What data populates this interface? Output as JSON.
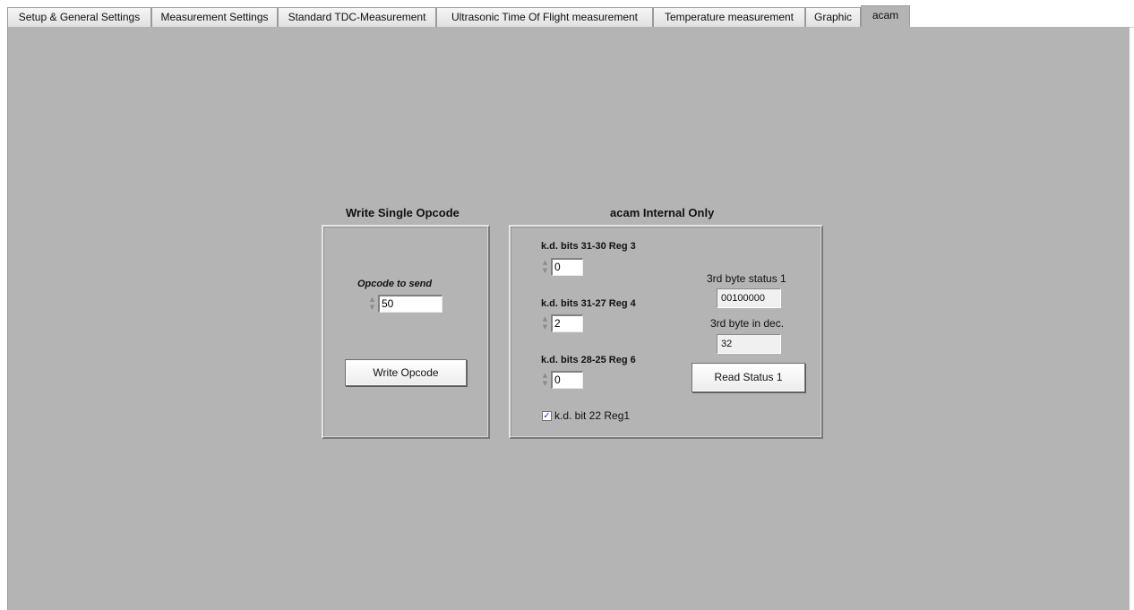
{
  "tabs": [
    {
      "label": "Setup & General Settings",
      "active": false
    },
    {
      "label": "Measurement Settings",
      "active": false
    },
    {
      "label": "Standard TDC-Measurement",
      "active": false
    },
    {
      "label": "Ultrasonic Time Of Flight measurement",
      "active": false
    },
    {
      "label": "Temperature measurement",
      "active": false
    },
    {
      "label": "Graphic",
      "active": false
    },
    {
      "label": "acam",
      "active": true
    }
  ],
  "write_opcode": {
    "title": "Write Single Opcode",
    "opcode_label": "Opcode to send",
    "opcode_value": "50",
    "button_label": "Write Opcode"
  },
  "internal": {
    "title": "acam Internal Only",
    "reg3_label": "k.d. bits 31-30 Reg 3",
    "reg3_value": "0",
    "reg4_label": "k.d. bits 31-27 Reg 4",
    "reg4_value": "2",
    "reg6_label": "k.d. bits 28-25 Reg 6",
    "reg6_value": "0",
    "checkbox_label": "k.d. bit 22 Reg1",
    "checkbox_checked": true,
    "status_label": "3rd byte status 1",
    "status_value": "00100000",
    "dec_label": "3rd byte in dec.",
    "dec_value": "32",
    "read_button_label": "Read Status 1"
  },
  "icons": {
    "spin_up": "▲",
    "spin_down": "▼",
    "check": "✓"
  }
}
